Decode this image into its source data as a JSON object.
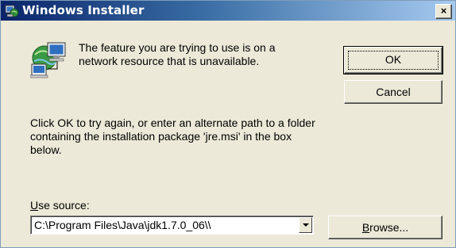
{
  "window": {
    "title": "Windows Installer",
    "close_label": "×"
  },
  "message": "The feature you are trying to use is on a network resource that is unavailable.",
  "instruction": "Click OK to try again, or enter an alternate path to a folder containing the installation package 'jre.msi' in the box below.",
  "buttons": {
    "ok_label": "OK",
    "cancel_label": "Cancel",
    "browse_prefix": "B",
    "browse_rest": "rowse..."
  },
  "source": {
    "label_accel": "U",
    "label_rest": "se source:",
    "value": "C:\\Program Files\\Java\\jdk1.7.0_06\\\\"
  }
}
